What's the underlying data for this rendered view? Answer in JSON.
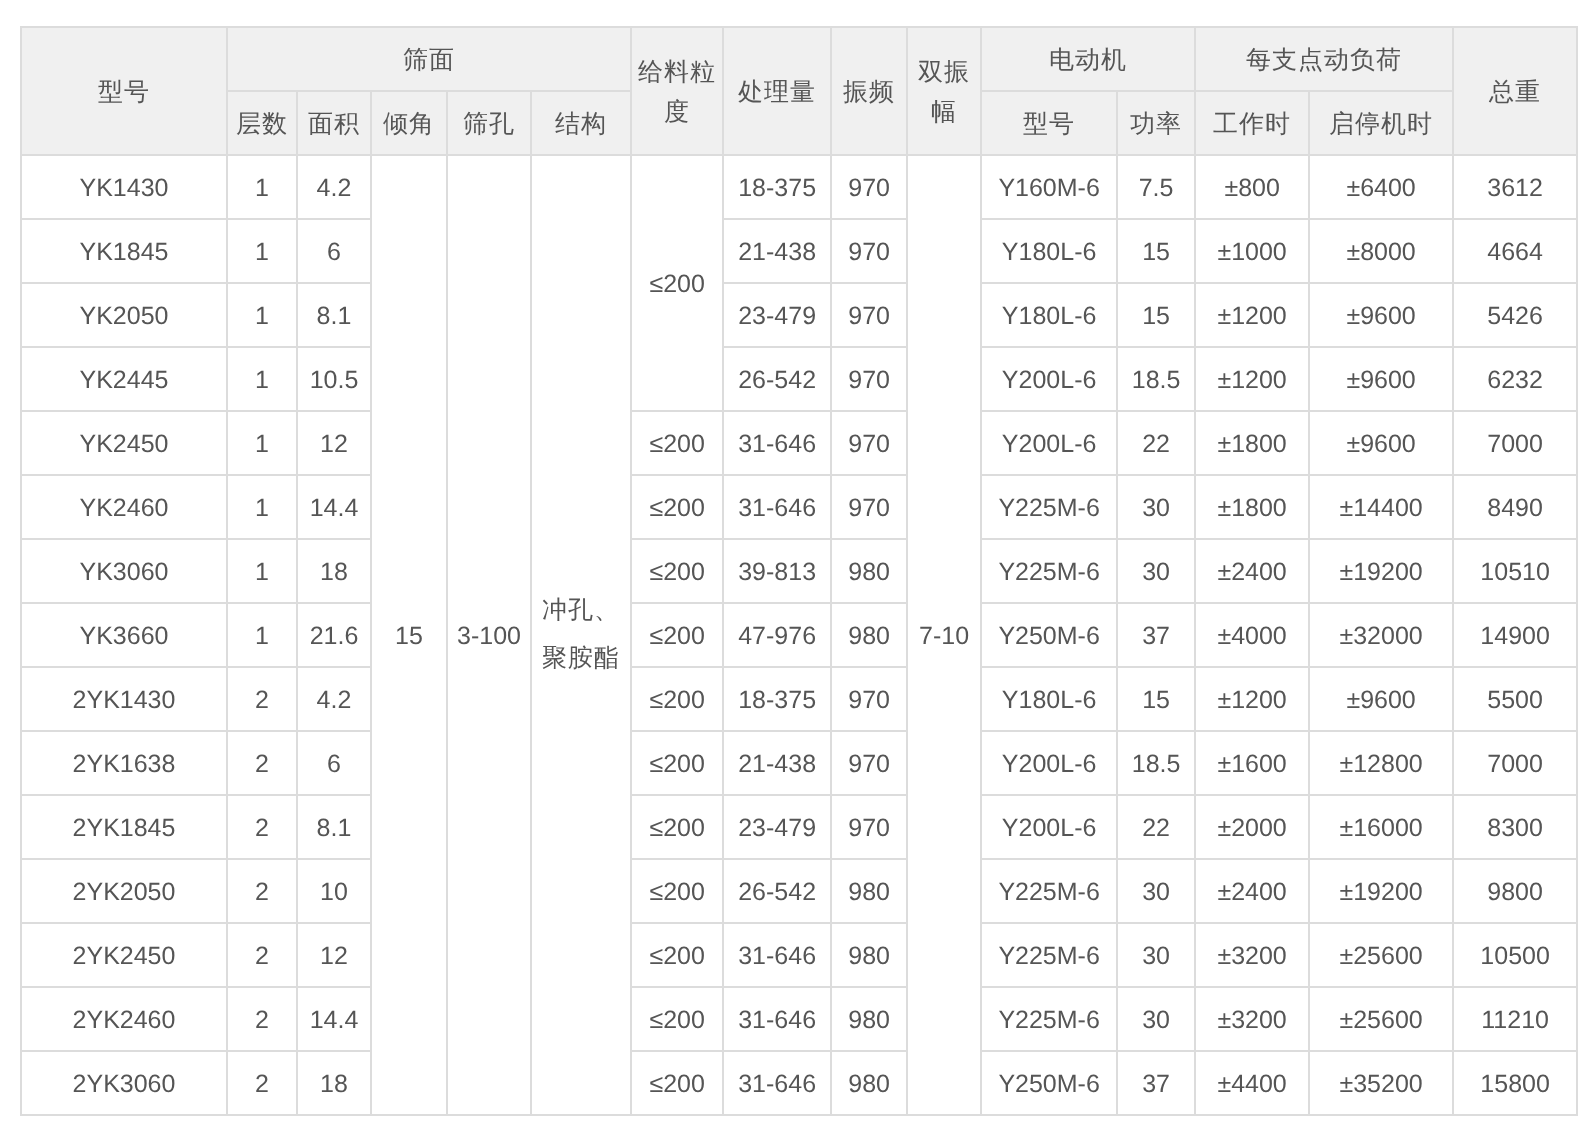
{
  "table": {
    "headers": [
      {
        "label": "型号"
      },
      {
        "label": "筛面",
        "sub": [
          "层数",
          "面积",
          "倾角",
          "筛孔",
          "结构"
        ]
      },
      {
        "label": "给料粒度"
      },
      {
        "label": "处理量"
      },
      {
        "label": "振频"
      },
      {
        "label": "双振幅"
      },
      {
        "label": "电动机",
        "sub": [
          "型号",
          "功率"
        ]
      },
      {
        "label": "每支点动负荷",
        "sub": [
          "工作时",
          "启停机时"
        ]
      },
      {
        "label": "总重"
      }
    ],
    "shared": {
      "angle": "15",
      "aperture": "3-100",
      "structure": "冲孔、聚胺酯",
      "amplitude": "7-10"
    },
    "rows": [
      {
        "model": "YK1430",
        "layers": "1",
        "area": "4.2",
        "feed": "≤200",
        "capacity": "18-375",
        "frequency": "970",
        "motor": "Y160M-6",
        "power": "7.5",
        "working_load": "±800",
        "start_stop_load": "±6400",
        "weight": "3612"
      },
      {
        "model": "YK1845",
        "layers": "1",
        "area": "6",
        "capacity": "21-438",
        "frequency": "970",
        "motor": "Y180L-6",
        "power": "15",
        "working_load": "±1000",
        "start_stop_load": "±8000",
        "weight": "4664"
      },
      {
        "model": "YK2050",
        "layers": "1",
        "area": "8.1",
        "capacity": "23-479",
        "frequency": "970",
        "motor": "Y180L-6",
        "power": "15",
        "working_load": "±1200",
        "start_stop_load": "±9600",
        "weight": "5426"
      },
      {
        "model": "YK2445",
        "layers": "1",
        "area": "10.5",
        "capacity": "26-542",
        "frequency": "970",
        "motor": "Y200L-6",
        "power": "18.5",
        "working_load": "±1200",
        "start_stop_load": "±9600",
        "weight": "6232"
      },
      {
        "model": "YK2450",
        "layers": "1",
        "area": "12",
        "feed": "≤200",
        "capacity": "31-646",
        "frequency": "970",
        "motor": "Y200L-6",
        "power": "22",
        "working_load": "±1800",
        "start_stop_load": "±9600",
        "weight": "7000"
      },
      {
        "model": "YK2460",
        "layers": "1",
        "area": "14.4",
        "feed": "≤200",
        "capacity": "31-646",
        "frequency": "970",
        "motor": "Y225M-6",
        "power": "30",
        "working_load": "±1800",
        "start_stop_load": "±14400",
        "weight": "8490"
      },
      {
        "model": "YK3060",
        "layers": "1",
        "area": "18",
        "feed": "≤200",
        "capacity": "39-813",
        "frequency": "980",
        "motor": "Y225M-6",
        "power": "30",
        "working_load": "±2400",
        "start_stop_load": "±19200",
        "weight": "10510"
      },
      {
        "model": "YK3660",
        "layers": "1",
        "area": "21.6",
        "feed": "≤200",
        "capacity": "47-976",
        "frequency": "980",
        "motor": "Y250M-6",
        "power": "37",
        "working_load": "±4000",
        "start_stop_load": "±32000",
        "weight": "14900"
      },
      {
        "model": "2YK1430",
        "layers": "2",
        "area": "4.2",
        "feed": "≤200",
        "capacity": "18-375",
        "frequency": "970",
        "motor": "Y180L-6",
        "power": "15",
        "working_load": "±1200",
        "start_stop_load": "±9600",
        "weight": "5500"
      },
      {
        "model": "2YK1638",
        "layers": "2",
        "area": "6",
        "feed": "≤200",
        "capacity": "21-438",
        "frequency": "970",
        "motor": "Y200L-6",
        "power": "18.5",
        "working_load": "±1600",
        "start_stop_load": "±12800",
        "weight": "7000"
      },
      {
        "model": "2YK1845",
        "layers": "2",
        "area": "8.1",
        "feed": "≤200",
        "capacity": "23-479",
        "frequency": "970",
        "motor": "Y200L-6",
        "power": "22",
        "working_load": "±2000",
        "start_stop_load": "±16000",
        "weight": "8300"
      },
      {
        "model": "2YK2050",
        "layers": "2",
        "area": "10",
        "feed": "≤200",
        "capacity": "26-542",
        "frequency": "980",
        "motor": "Y225M-6",
        "power": "30",
        "working_load": "±2400",
        "start_stop_load": "±19200",
        "weight": "9800"
      },
      {
        "model": "2YK2450",
        "layers": "2",
        "area": "12",
        "feed": "≤200",
        "capacity": "31-646",
        "frequency": "980",
        "motor": "Y225M-6",
        "power": "30",
        "working_load": "±3200",
        "start_stop_load": "±25600",
        "weight": "10500"
      },
      {
        "model": "2YK2460",
        "layers": "2",
        "area": "14.4",
        "feed": "≤200",
        "capacity": "31-646",
        "frequency": "980",
        "motor": "Y225M-6",
        "power": "30",
        "working_load": "±3200",
        "start_stop_load": "±25600",
        "weight": "11210"
      },
      {
        "model": "2YK3060",
        "layers": "2",
        "area": "18",
        "feed": "≤200",
        "capacity": "31-646",
        "frequency": "980",
        "motor": "Y250M-6",
        "power": "37",
        "working_load": "±4400",
        "start_stop_load": "±35200",
        "weight": "15800"
      }
    ]
  }
}
